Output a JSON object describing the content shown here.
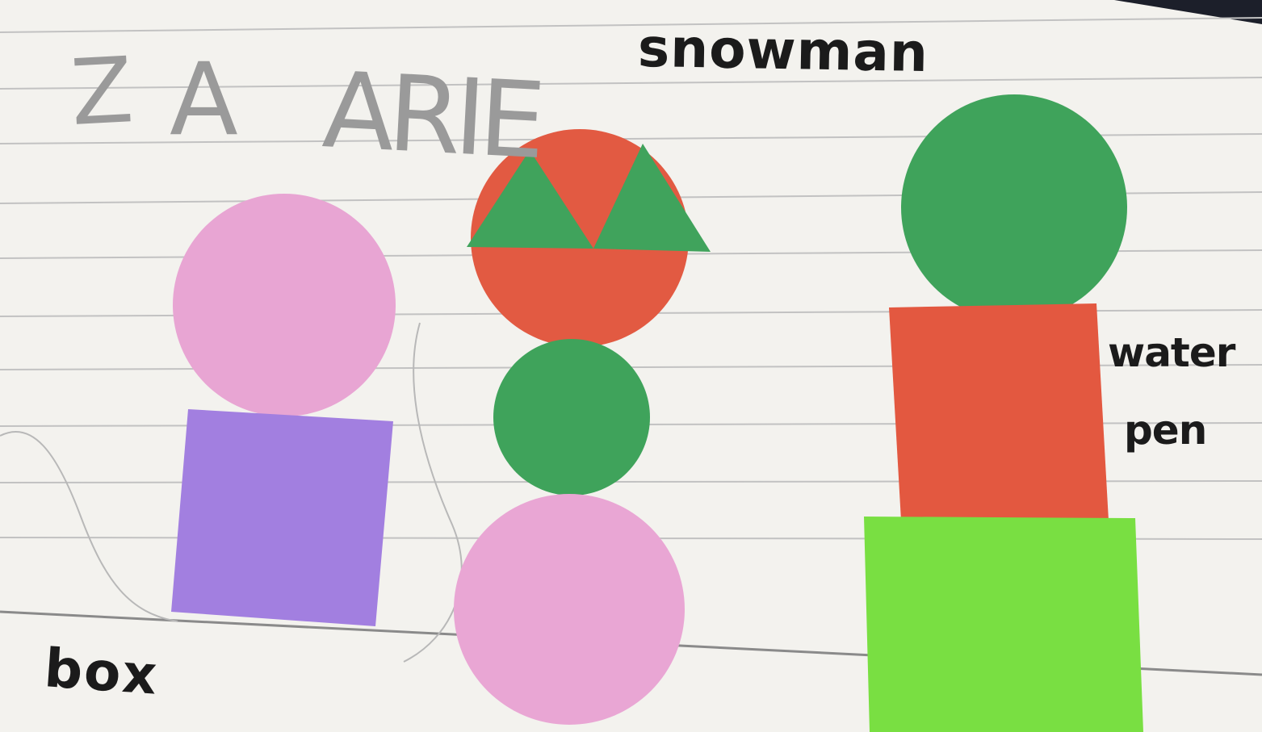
{
  "labels": {
    "snowman": "snowman",
    "box": "box",
    "water": "water",
    "pen": "pen"
  },
  "pencil_name": {
    "z": "Z",
    "a": "A",
    "arie": "ARIE"
  },
  "colors": {
    "card": "#f3f2ee",
    "ruled_line": "#bdbdbd",
    "pink": "#e9a6d4",
    "purple": "#a27fe0",
    "orange_red": "#e35840",
    "green": "#3fa35b",
    "lime": "#79df42"
  }
}
